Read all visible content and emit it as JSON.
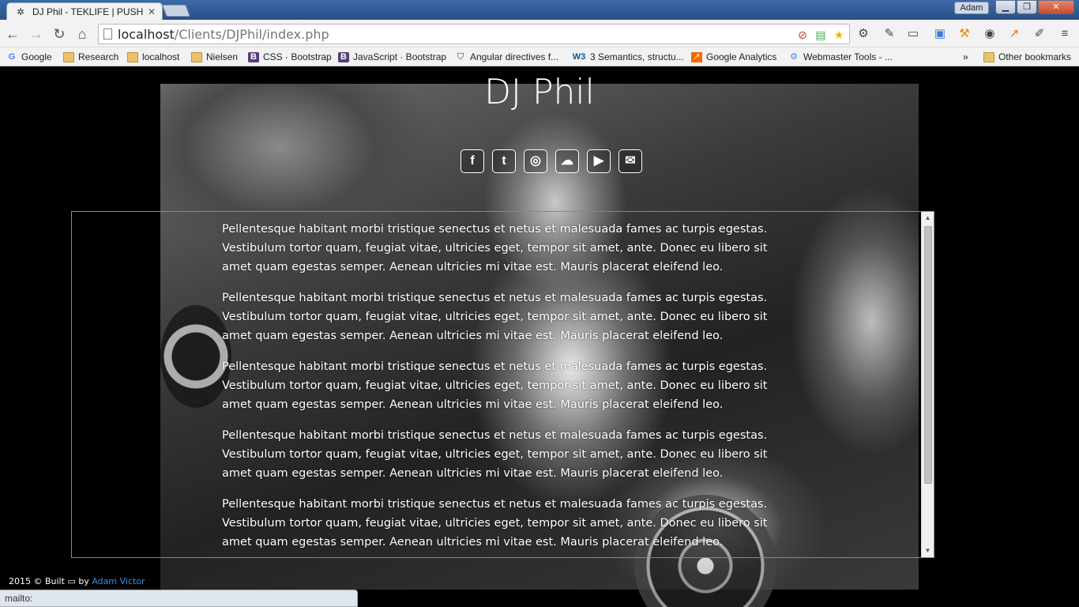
{
  "browser": {
    "tab_title": "DJ Phil - TEKLIFE | PUSH BI",
    "user_badge": "Adam",
    "url_host": "localhost",
    "url_path": "/Clients/DJPhil/index.php",
    "bookmarks": [
      {
        "label": "Google",
        "icon": "google-icon"
      },
      {
        "label": "Research",
        "icon": "folder-icon"
      },
      {
        "label": "localhost",
        "icon": "folder-icon"
      },
      {
        "label": "Nielsen",
        "icon": "folder-icon"
      },
      {
        "label": "CSS · Bootstrap",
        "icon": "bootstrap-icon"
      },
      {
        "label": "JavaScript · Bootstrap",
        "icon": "bootstrap-icon"
      },
      {
        "label": "Angular directives f...",
        "icon": "shield-icon"
      },
      {
        "label": "3 Semantics, structu...",
        "icon": "w3-icon"
      },
      {
        "label": "Google Analytics",
        "icon": "analytics-icon"
      },
      {
        "label": "Webmaster Tools - ...",
        "icon": "webmaster-icon"
      }
    ],
    "overflow_label": "»",
    "other_bookmarks": "Other bookmarks",
    "status_text": "mailto:"
  },
  "page": {
    "title": "DJ Phil",
    "socials": [
      {
        "name": "facebook",
        "glyph": "f"
      },
      {
        "name": "twitter",
        "glyph": "t"
      },
      {
        "name": "instagram",
        "glyph": "◎"
      },
      {
        "name": "soundcloud",
        "glyph": "☁"
      },
      {
        "name": "youtube",
        "glyph": "▶"
      },
      {
        "name": "email",
        "glyph": "✉"
      }
    ],
    "paragraphs": [
      "Pellentesque habitant morbi tristique senectus et netus et malesuada fames ac turpis egestas. Vestibulum tortor quam, feugiat vitae, ultricies eget, tempor sit amet, ante. Donec eu libero sit amet quam egestas semper. Aenean ultricies mi vitae est. Mauris placerat eleifend leo.",
      "Pellentesque habitant morbi tristique senectus et netus et malesuada fames ac turpis egestas. Vestibulum tortor quam, feugiat vitae, ultricies eget, tempor sit amet, ante. Donec eu libero sit amet quam egestas semper. Aenean ultricies mi vitae est. Mauris placerat eleifend leo.",
      "Pellentesque habitant morbi tristique senectus et netus et malesuada fames ac turpis egestas. Vestibulum tortor quam, feugiat vitae, ultricies eget, tempor sit amet, ante. Donec eu libero sit amet quam egestas semper. Aenean ultricies mi vitae est. Mauris placerat eleifend leo.",
      "Pellentesque habitant morbi tristique senectus et netus et malesuada fames ac turpis egestas. Vestibulum tortor quam, feugiat vitae, ultricies eget, tempor sit amet, ante. Donec eu libero sit amet quam egestas semper. Aenean ultricies mi vitae est. Mauris placerat eleifend leo.",
      "Pellentesque habitant morbi tristique senectus et netus et malesuada fames ac turpis egestas. Vestibulum tortor quam, feugiat vitae, ultricies eget, tempor sit amet, ante. Donec eu libero sit amet quam egestas semper. Aenean ultricies mi vitae est. Mauris placerat eleifend leo."
    ],
    "footer": {
      "prefix": "2015 © Built",
      "by": "by",
      "author": "Adam Victor"
    }
  },
  "colors": {
    "background": "#000000",
    "link": "#3a8dde",
    "text": "#ffffff"
  }
}
